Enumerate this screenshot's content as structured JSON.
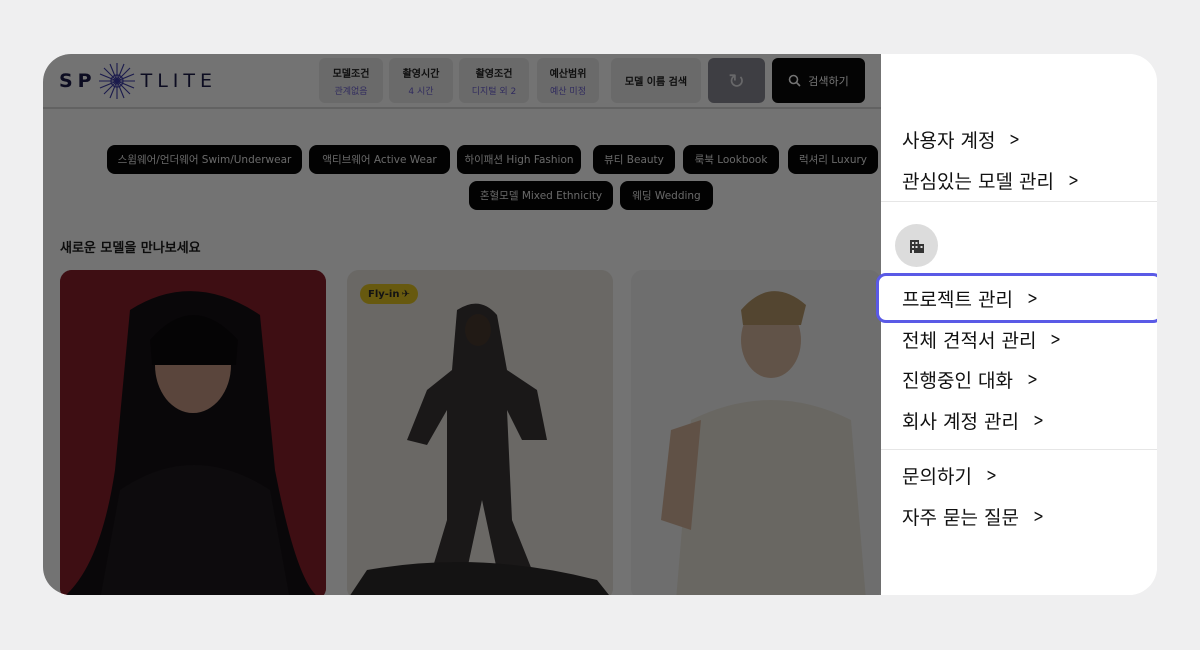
{
  "app": {
    "logo_left": "SP",
    "logo_right": "TLITE",
    "filters": [
      {
        "label": "모델조건",
        "value": "관계없음"
      },
      {
        "label": "촬영시간",
        "value": "4 시간"
      },
      {
        "label": "촬영조건",
        "value": "디지털 외 2"
      },
      {
        "label": "예산범위",
        "value": "예산 미정"
      }
    ],
    "name_search_label": "모델 이름 검색",
    "search_button_label": "검색하기",
    "categories_row1": [
      "스윔웨어/언더웨어 Swim/Underwear",
      "액티브웨어 Active Wear",
      "하이패션 High Fashion",
      "뷰티 Beauty",
      "룩북 Lookbook",
      "럭셔리 Luxury"
    ],
    "categories_row2": [
      "혼혈모델 Mixed Ethnicity",
      "웨딩 Wedding"
    ],
    "section_title": "새로운 모델을 만나보세요",
    "card_badge": "Fly-in"
  },
  "menu": {
    "group1": [
      "사용자 계정",
      "관심있는 모델 관리"
    ],
    "icon": "building-icon",
    "group2": [
      "프로젝트 관리",
      "전체 견적서 관리",
      "진행중인 대화",
      "회사 계정 관리"
    ],
    "group3": [
      "문의하기",
      "자주 묻는 질문"
    ],
    "highlighted": "프로젝트 관리"
  },
  "colors": {
    "highlight_border": "#5a5ae6",
    "logo": "#1c1c4a",
    "badge": "#e4c623",
    "filter_value": "#6b5fd0"
  }
}
